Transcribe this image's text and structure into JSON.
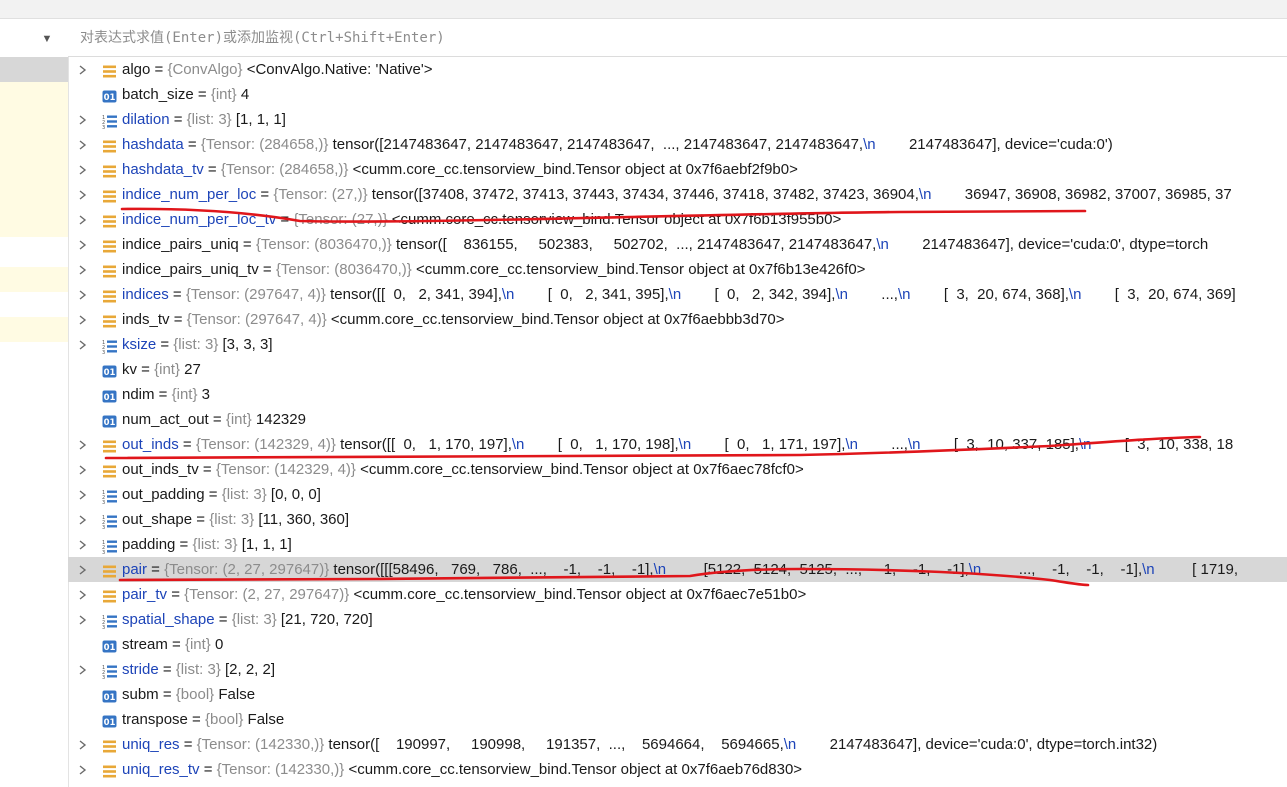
{
  "eval": {
    "placeholder": "对表达式求值(Enter)或添加监视(Ctrl+Shift+Enter)"
  },
  "variables": [
    {
      "name": "algo",
      "type": "{ConvAlgo}",
      "value": "<ConvAlgo.Native: 'Native'>",
      "icon": "object-icon",
      "expandable": true,
      "changed": false
    },
    {
      "name": "batch_size",
      "type": "{int}",
      "value": "4",
      "icon": "int-icon",
      "expandable": false,
      "changed": false
    },
    {
      "name": "dilation",
      "type": "{list: 3}",
      "value": "[1, 1, 1]",
      "icon": "list-icon",
      "expandable": true,
      "changed": true
    },
    {
      "name": "hashdata",
      "type": "{Tensor: (284658,)}",
      "value": "tensor([2147483647, 2147483647, 2147483647,  ..., 2147483647, 2147483647,\\n        2147483647], device='cuda:0')",
      "icon": "object-icon",
      "expandable": true,
      "changed": true
    },
    {
      "name": "hashdata_tv",
      "type": "{Tensor: (284658,)}",
      "value": "<cumm.core_cc.tensorview_bind.Tensor object at 0x7f6aebf2f9b0>",
      "icon": "object-icon",
      "expandable": true,
      "changed": true
    },
    {
      "name": "indice_num_per_loc",
      "type": "{Tensor: (27,)}",
      "value": "tensor([37408, 37472, 37413, 37443, 37434, 37446, 37418, 37482, 37423, 36904,\\n        36947, 36908, 36982, 37007, 36985, 37",
      "icon": "object-icon",
      "expandable": true,
      "changed": true
    },
    {
      "name": "indice_num_per_loc_tv",
      "type": "{Tensor: (27,)}",
      "value": "<cumm.core_cc.tensorview_bind.Tensor object at 0x7f6b13f955b0>",
      "icon": "object-icon",
      "expandable": true,
      "changed": true
    },
    {
      "name": "indice_pairs_uniq",
      "type": "{Tensor: (8036470,)}",
      "value": "tensor([    836155,     502383,     502702,  ..., 2147483647, 2147483647,\\n        2147483647], device='cuda:0', dtype=torch",
      "icon": "object-icon",
      "expandable": true,
      "changed": false
    },
    {
      "name": "indice_pairs_uniq_tv",
      "type": "{Tensor: (8036470,)}",
      "value": "<cumm.core_cc.tensorview_bind.Tensor object at 0x7f6b13e426f0>",
      "icon": "object-icon",
      "expandable": true,
      "changed": false
    },
    {
      "name": "indices",
      "type": "{Tensor: (297647, 4)}",
      "value": "tensor([[  0,   2, 341, 394],\\n        [  0,   2, 341, 395],\\n        [  0,   2, 342, 394],\\n        ...,\\n        [  3,  20, 674, 368],\\n        [  3,  20, 674, 369]",
      "icon": "object-icon",
      "expandable": true,
      "changed": true
    },
    {
      "name": "inds_tv",
      "type": "{Tensor: (297647, 4)}",
      "value": "<cumm.core_cc.tensorview_bind.Tensor object at 0x7f6aebbb3d70>",
      "icon": "object-icon",
      "expandable": true,
      "changed": false
    },
    {
      "name": "ksize",
      "type": "{list: 3}",
      "value": "[3, 3, 3]",
      "icon": "list-icon",
      "expandable": true,
      "changed": true
    },
    {
      "name": "kv",
      "type": "{int}",
      "value": "27",
      "icon": "int-icon",
      "expandable": false,
      "changed": false
    },
    {
      "name": "ndim",
      "type": "{int}",
      "value": "3",
      "icon": "int-icon",
      "expandable": false,
      "changed": false
    },
    {
      "name": "num_act_out",
      "type": "{int}",
      "value": "142329",
      "icon": "int-icon",
      "expandable": false,
      "changed": false
    },
    {
      "name": "out_inds",
      "type": "{Tensor: (142329, 4)}",
      "value": "tensor([[  0,   1, 170, 197],\\n        [  0,   1, 170, 198],\\n        [  0,   1, 171, 197],\\n        ...,\\n        [  3,  10, 337, 185],\\n        [  3,  10, 338, 18",
      "icon": "object-icon",
      "expandable": true,
      "changed": true
    },
    {
      "name": "out_inds_tv",
      "type": "{Tensor: (142329, 4)}",
      "value": "<cumm.core_cc.tensorview_bind.Tensor object at 0x7f6aec78fcf0>",
      "icon": "object-icon",
      "expandable": true,
      "changed": false
    },
    {
      "name": "out_padding",
      "type": "{list: 3}",
      "value": "[0, 0, 0]",
      "icon": "list-icon",
      "expandable": true,
      "changed": false
    },
    {
      "name": "out_shape",
      "type": "{list: 3}",
      "value": "[11, 360, 360]",
      "icon": "list-icon",
      "expandable": true,
      "changed": false
    },
    {
      "name": "padding",
      "type": "{list: 3}",
      "value": "[1, 1, 1]",
      "icon": "list-icon",
      "expandable": true,
      "changed": false
    },
    {
      "name": "pair",
      "type": "{Tensor: (2, 27, 297647)}",
      "value": "tensor([[[58496,   769,   786,  ...,    -1,    -1,    -1],\\n         [5122,  5124,  5125,  ...,    -1,    -1,    -1],\\n         ...,    -1,    -1,    -1],\\n         [ 1719,",
      "icon": "object-icon",
      "expandable": true,
      "changed": true,
      "selected": true
    },
    {
      "name": "pair_tv",
      "type": "{Tensor: (2, 27, 297647)}",
      "value": "<cumm.core_cc.tensorview_bind.Tensor object at 0x7f6aec7e51b0>",
      "icon": "object-icon",
      "expandable": true,
      "changed": true
    },
    {
      "name": "spatial_shape",
      "type": "{list: 3}",
      "value": "[21, 720, 720]",
      "icon": "list-icon",
      "expandable": true,
      "changed": true
    },
    {
      "name": "stream",
      "type": "{int}",
      "value": "0",
      "icon": "int-icon",
      "expandable": false,
      "changed": false
    },
    {
      "name": "stride",
      "type": "{list: 3}",
      "value": "[2, 2, 2]",
      "icon": "list-icon",
      "expandable": true,
      "changed": true
    },
    {
      "name": "subm",
      "type": "{bool}",
      "value": "False",
      "icon": "bool-icon",
      "expandable": false,
      "changed": false
    },
    {
      "name": "transpose",
      "type": "{bool}",
      "value": "False",
      "icon": "bool-icon",
      "expandable": false,
      "changed": false
    },
    {
      "name": "uniq_res",
      "type": "{Tensor: (142330,)}",
      "value": "tensor([    190997,     190998,     191357,  ...,    5694664,    5694665,\\n        2147483647], device='cuda:0', dtype=torch.int32)",
      "icon": "object-icon",
      "expandable": true,
      "changed": true
    },
    {
      "name": "uniq_res_tv",
      "type": "{Tensor: (142330,)}",
      "value": "<cumm.core_cc.tensorview_bind.Tensor object at 0x7f6aeb76d830>",
      "icon": "object-icon",
      "expandable": true,
      "changed": true
    }
  ],
  "colors": {
    "changed_name": "#1d44b8",
    "type_hint": "#8c8c8c",
    "selection": "#d7d7d7",
    "object_icon": "#e8a838",
    "int_icon": "#3574c4",
    "annotation_red": "#e0161b",
    "sidebar_highlight_yellow": "#fffbe3",
    "sidebar_selected": "#d7d7d7"
  },
  "sidebar": {
    "collapse_icon": "chevron-down-icon"
  }
}
